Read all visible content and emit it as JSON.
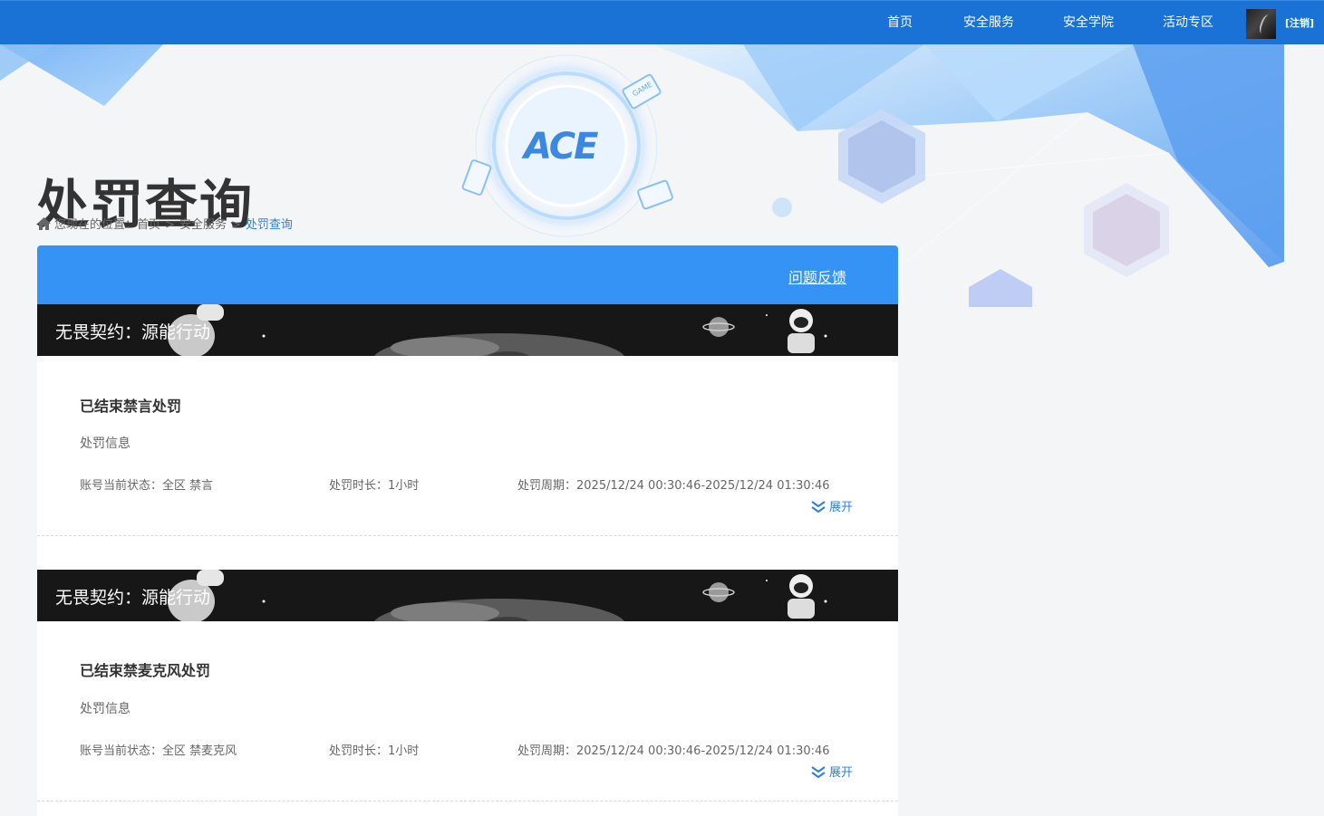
{
  "nav": {
    "items": [
      "首页",
      "安全服务",
      "安全学院",
      "活动专区"
    ],
    "logout": "[注销]"
  },
  "banner": {
    "title": "处罚查询",
    "logo_text": "ACE",
    "badge_text": "GAME"
  },
  "breadcrumb": {
    "prefix": "您现在的位置：",
    "items": [
      "首页",
      "安全服务",
      "处罚查询"
    ],
    "separator": ">"
  },
  "card": {
    "feedback": "问题反馈"
  },
  "records": [
    {
      "game": "无畏契约：源能行动",
      "title": "已结束禁言处罚",
      "subtitle": "处罚信息",
      "status": "账号当前状态：全区 禁言",
      "duration": "处罚时长：1小时",
      "period": "处罚周期：2025/12/24 00:30:46-2025/12/24 01:30:46",
      "expand": "展开"
    },
    {
      "game": "无畏契约：源能行动",
      "title": "已结束禁麦克风处罚",
      "subtitle": "处罚信息",
      "status": "账号当前状态：全区 禁麦克风",
      "duration": "处罚时长：1小时",
      "period": "处罚周期：2025/12/24 00:30:46-2025/12/24 01:30:46",
      "expand": "展开"
    }
  ],
  "colors": {
    "nav_bg": "#1a72d6",
    "card_header": "#3593f5",
    "link_blue": "#2f7fd9"
  }
}
